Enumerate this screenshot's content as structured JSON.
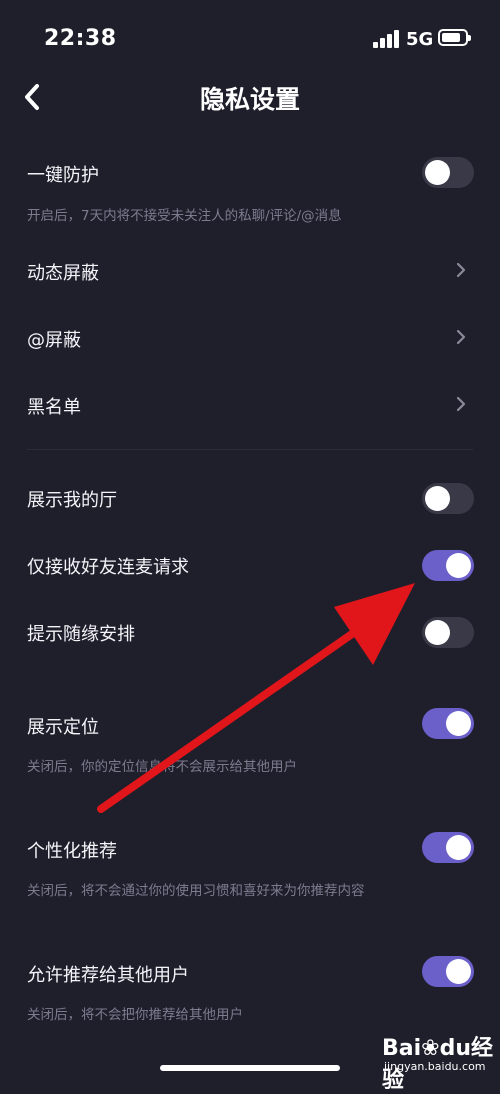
{
  "status_bar": {
    "time": "22:38",
    "network": "5G"
  },
  "header": {
    "title": "隐私设置"
  },
  "settings": {
    "one_key_protect": {
      "label": "一键防护",
      "desc": "开启后，7天内将不接受未关注人的私聊/评论/@消息",
      "enabled": false
    },
    "dynamic_block": {
      "label": "动态屏蔽"
    },
    "at_block": {
      "label": "@屏蔽"
    },
    "blacklist": {
      "label": "黑名单"
    },
    "show_my_hall": {
      "label": "展示我的厅",
      "enabled": false
    },
    "friend_mic_only": {
      "label": "仅接收好友连麦请求",
      "enabled": true
    },
    "random_arrange": {
      "label": "提示随缘安排",
      "enabled": false
    },
    "show_location": {
      "label": "展示定位",
      "desc": "关闭后，你的定位信息将不会展示给其他用户",
      "enabled": true
    },
    "personalized": {
      "label": "个性化推荐",
      "desc": "关闭后，将不会通过你的使用习惯和喜好来为你推荐内容",
      "enabled": true
    },
    "recommend_to_others": {
      "label": "允许推荐给其他用户",
      "desc": "关闭后，将不会把你推荐给其他用户",
      "enabled": true
    }
  },
  "colors": {
    "background": "#1f1e2b",
    "toggle_on": "#6b5fc9",
    "toggle_off": "#3a3947",
    "annotation_arrow": "#e0161b"
  },
  "icons": {
    "back": "chevron-left-icon",
    "chevron": "chevron-right-icon"
  },
  "watermark": {
    "logo": "Bai",
    "logo_suffix": "du",
    "brand": "经验",
    "url": "jingyan.baidu.com"
  }
}
